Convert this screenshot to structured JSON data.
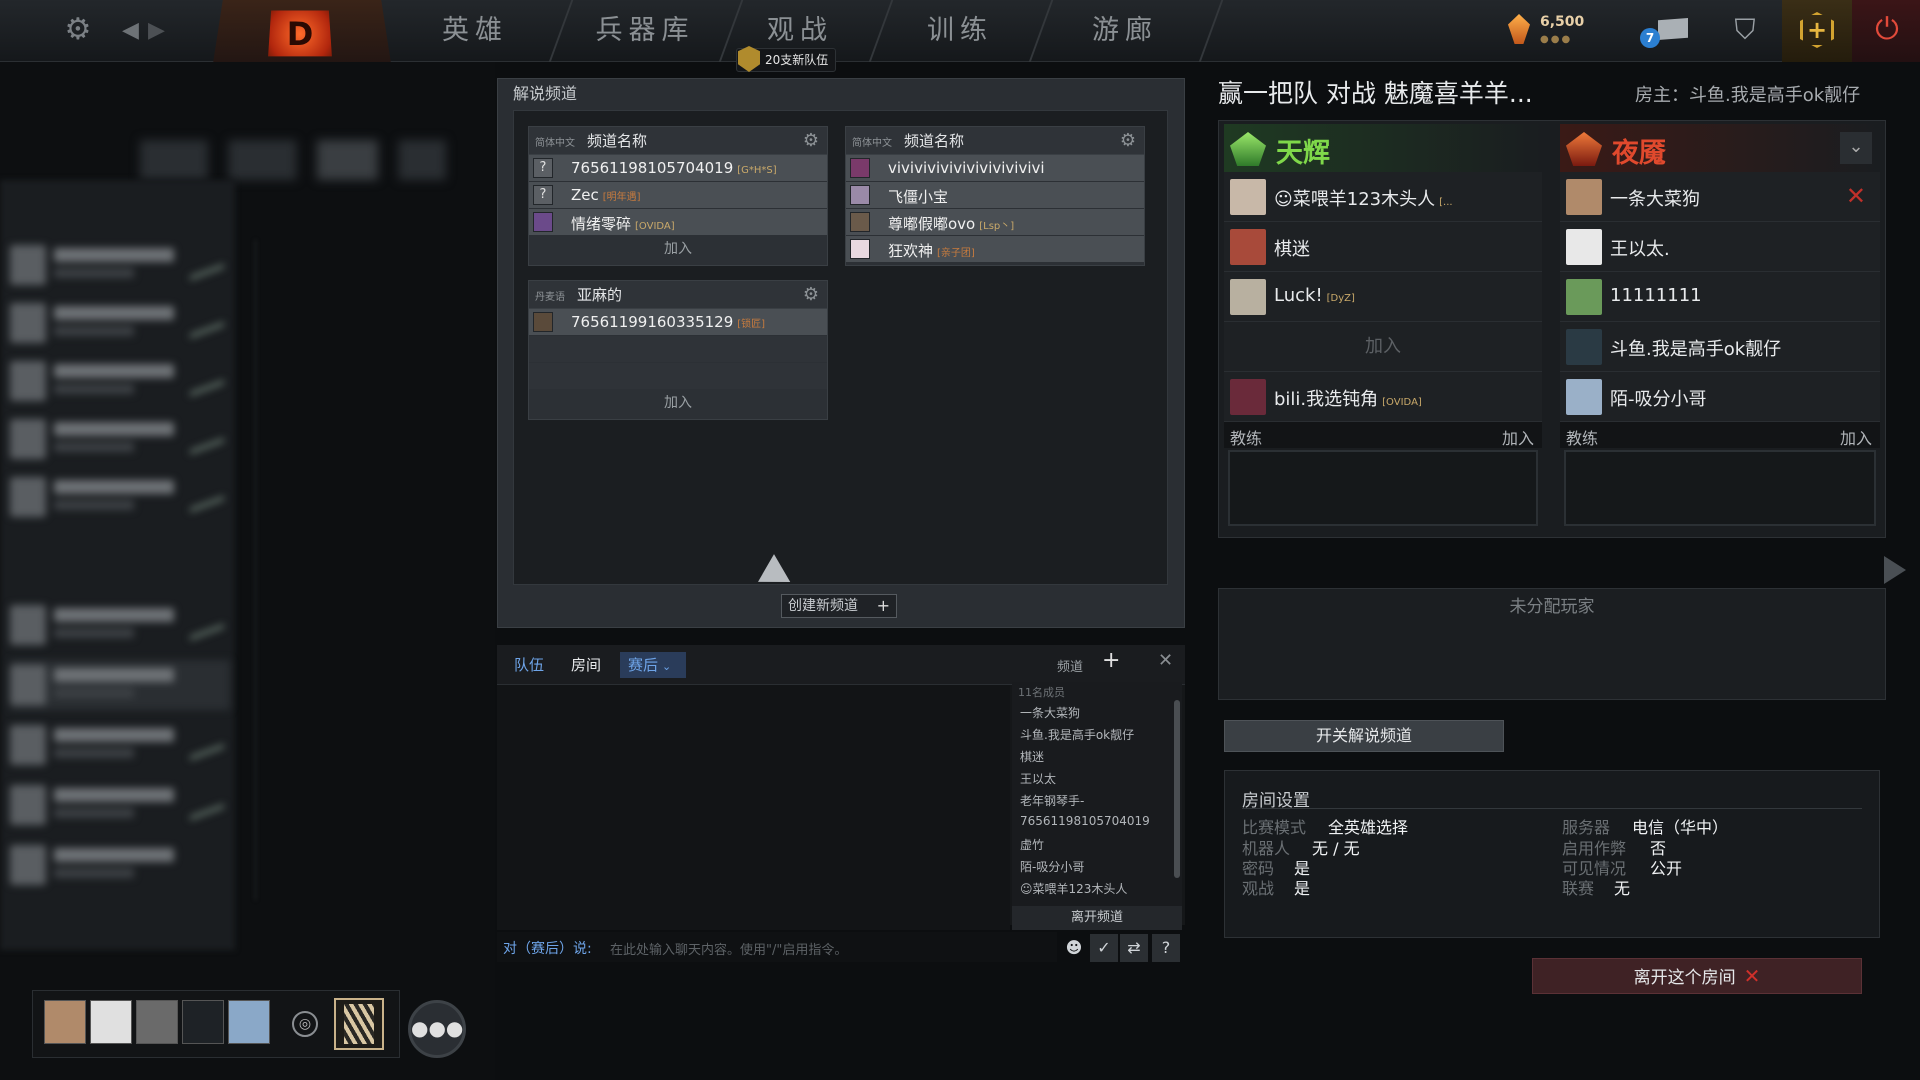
{
  "nav": {
    "items": [
      "英雄",
      "兵器库",
      "观战",
      "训练",
      "游廊"
    ],
    "new_team_badge": "20支新队伍",
    "shards": "6,500",
    "mail_count": "7",
    "logo_glyph": "D"
  },
  "caster": {
    "title": "解说频道",
    "create_label": "创建新频道",
    "channels": [
      {
        "lang": "简体中文",
        "name": "频道名称",
        "members": [
          {
            "name": "76561198105704019",
            "tag": "[G*H*S]"
          },
          {
            "name": "Zec",
            "tag": "[明年遇]"
          },
          {
            "name": "情绪零碎",
            "tag": "[OVIDA]"
          }
        ],
        "join_label": "加入"
      },
      {
        "lang": "简体中文",
        "name": "频道名称",
        "members": [
          {
            "name": "vivivivivivivivivivivivi",
            "tag": ""
          },
          {
            "name": "飞僵小宝",
            "tag": ""
          },
          {
            "name": "尊嘟假嘟ovo",
            "tag": "[Lsp丶]"
          },
          {
            "name": "狂欢神",
            "tag": "[亲子团]"
          }
        ]
      },
      {
        "lang": "丹麦语",
        "name": "亚麻的",
        "members": [
          {
            "name": "76561199160335129",
            "tag": "[锁匠]"
          }
        ],
        "join_label": "加入"
      }
    ]
  },
  "chat": {
    "tabs": [
      "队伍",
      "房间",
      "赛后"
    ],
    "channel_label": "频道",
    "member_count": "11名成员",
    "members": [
      "一条大菜狗",
      "斗鱼.我是高手ok靓仔",
      "棋迷",
      "王以太",
      "老年钢琴手-",
      "76561198105704019",
      "虚竹",
      "陌-吸分小哥",
      "☺菜喂羊123木头人"
    ],
    "leave_channel": "离开频道",
    "prefix": "对（赛后）说:",
    "placeholder": "在此处输入聊天内容。使用\"/\"启用指令。"
  },
  "lobby": {
    "title": "赢一把队 对战 魅魔喜羊羊...",
    "host": "房主：斗鱼.我是高手ok靓仔",
    "radiant": {
      "name": "天辉",
      "players": [
        {
          "name": "☺菜喂羊123木头人",
          "tag": "[..."
        },
        {
          "name": "棋迷",
          "tag": ""
        },
        {
          "name": "Luck!",
          "tag": "[DyZ]"
        },
        {
          "name": "",
          "tag": ""
        },
        {
          "name": "bili.我选钝角",
          "tag": "[OVIDA]"
        }
      ],
      "join_label": "加入",
      "coach_label": "教练",
      "coach_join": "加入"
    },
    "dire": {
      "name": "夜魇",
      "players": [
        {
          "name": "一条大菜狗",
          "tag": ""
        },
        {
          "name": "王以太.",
          "tag": ""
        },
        {
          "name": "11111111",
          "tag": ""
        },
        {
          "name": "斗鱼.我是高手ok靓仔",
          "tag": ""
        },
        {
          "name": "陌-吸分小哥",
          "tag": ""
        }
      ],
      "coach_label": "教练",
      "coach_join": "加入"
    },
    "unassigned": "未分配玩家",
    "toggle_caster": "开关解说频道",
    "settings": {
      "title": "房间设置",
      "left": [
        {
          "k": "比赛模式",
          "v": "全英雄选择"
        },
        {
          "k": "机器人",
          "v": "无 / 无"
        },
        {
          "k": "密码",
          "v": "是"
        },
        {
          "k": "观战",
          "v": "是"
        }
      ],
      "right": [
        {
          "k": "服务器",
          "v": "电信（华中）"
        },
        {
          "k": "启用作弊",
          "v": "否"
        },
        {
          "k": "可见情况",
          "v": "公开"
        },
        {
          "k": "联赛",
          "v": "无"
        }
      ]
    },
    "leave_room": "离开这个房间"
  },
  "colors": {
    "radiant": "#7fd84a",
    "dire": "#e0492d",
    "accent_blue": "#6ea4e8"
  }
}
